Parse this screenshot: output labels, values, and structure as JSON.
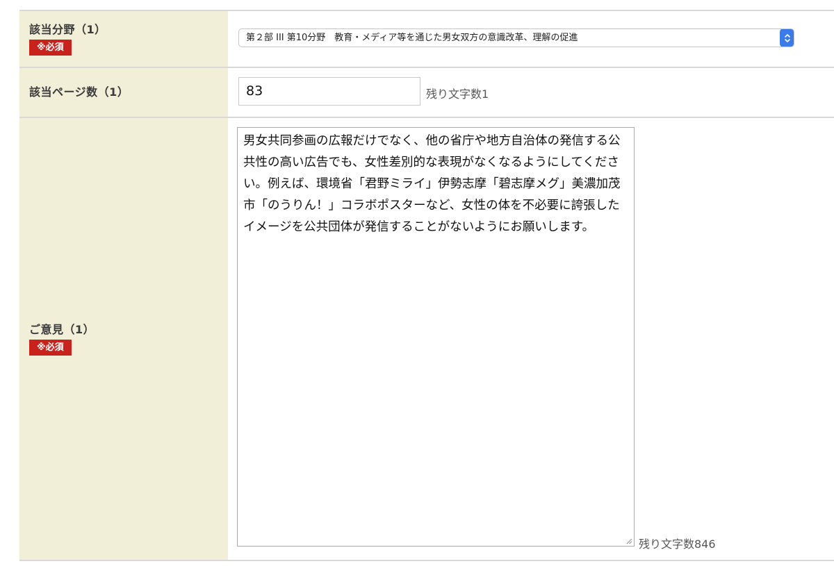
{
  "form": {
    "field_area": {
      "label": "該当分野（1）",
      "required_badge": "※必須",
      "selected_option": "第２部 III 第10分野　教育・メディア等を通じた男女双方の意識改革、理解の促進"
    },
    "field_page": {
      "label": "該当ページ数（1）",
      "value": "83",
      "remaining_text": "残り文字数1"
    },
    "field_opinion": {
      "label": "ご意見（1）",
      "required_badge": "※必須",
      "value": "男女共同参画の広報だけでなく、他の省庁や地方自治体の発信する公共性の高い広告でも、女性差別的な表現がなくなるようにしてください。例えば、環境省「君野ミライ」伊勢志摩「碧志摩メグ」美濃加茂市「のうりん！」コラボポスターなど、女性の体を不必要に誇張したイメージを公共団体が発信することがないようにお願いします。",
      "remaining_text": "残り文字数846"
    }
  },
  "colors": {
    "label_background": "#f1efd8",
    "required_badge": "#c8221c",
    "select_arrow": "#3a7be8",
    "row_border": "#d9d9d9"
  },
  "icons": {
    "select_arrow": "up-down-chevron-icon",
    "resize_grip": "resize-grip-icon"
  }
}
